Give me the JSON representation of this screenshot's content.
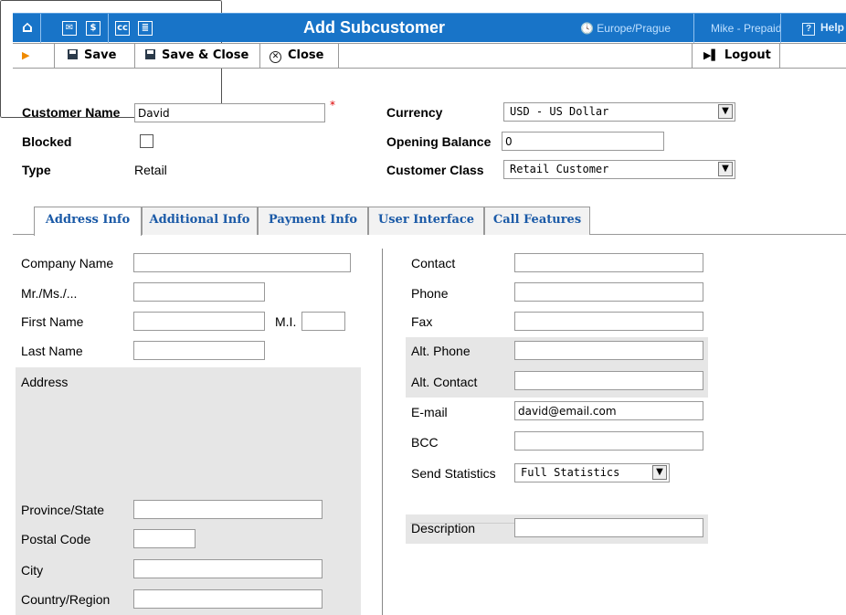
{
  "header": {
    "title": "Add Subcustomer",
    "timezone": "Europe/Prague",
    "user": "Mike - Prepaid",
    "help": "Help",
    "icons": [
      "home-icon",
      "mail-icon",
      "dollar-icon",
      "cc-icon",
      "list-icon"
    ],
    "bg_color": "#1874c8"
  },
  "toolbar": {
    "save": "Save",
    "save_close": "Save & Close",
    "close": "Close",
    "logout": "Logout"
  },
  "top_form": {
    "customer_name_label": "Customer Name",
    "customer_name_value": "David",
    "required_mark": "*",
    "blocked_label": "Blocked",
    "blocked_checked": false,
    "type_label": "Type",
    "type_value": "Retail",
    "currency_label": "Currency",
    "currency_value": "USD - US Dollar",
    "opening_balance_label": "Opening Balance",
    "opening_balance_value": "0",
    "customer_class_label": "Customer Class",
    "customer_class_value": "Retail Customer"
  },
  "tabs": [
    {
      "label": "Address Info",
      "active": true
    },
    {
      "label": "Additional Info",
      "active": false
    },
    {
      "label": "Payment Info",
      "active": false
    },
    {
      "label": "User Interface",
      "active": false
    },
    {
      "label": "Call Features",
      "active": false
    }
  ],
  "address_left": {
    "company_name": {
      "label": "Company Name",
      "value": ""
    },
    "salutation": {
      "label": "Mr./Ms./...",
      "value": ""
    },
    "first_name": {
      "label": "First Name",
      "value": ""
    },
    "mi": {
      "label": "M.I.",
      "value": ""
    },
    "last_name": {
      "label": "Last Name",
      "value": ""
    },
    "address": {
      "label": "Address",
      "value": ""
    },
    "province": {
      "label": "Province/State",
      "value": ""
    },
    "postal_code": {
      "label": "Postal Code",
      "value": ""
    },
    "city": {
      "label": "City",
      "value": ""
    },
    "country": {
      "label": "Country/Region",
      "value": ""
    }
  },
  "address_right": {
    "contact": {
      "label": "Contact",
      "value": ""
    },
    "phone": {
      "label": "Phone",
      "value": ""
    },
    "fax": {
      "label": "Fax",
      "value": ""
    },
    "alt_phone": {
      "label": "Alt. Phone",
      "value": ""
    },
    "alt_contact": {
      "label": "Alt. Contact",
      "value": ""
    },
    "email": {
      "label": "E-mail",
      "value": "david@email.com"
    },
    "bcc": {
      "label": "BCC",
      "value": ""
    },
    "send_statistics": {
      "label": "Send Statistics",
      "value": "Full Statistics"
    },
    "description": {
      "label": "Description",
      "value": ""
    }
  }
}
